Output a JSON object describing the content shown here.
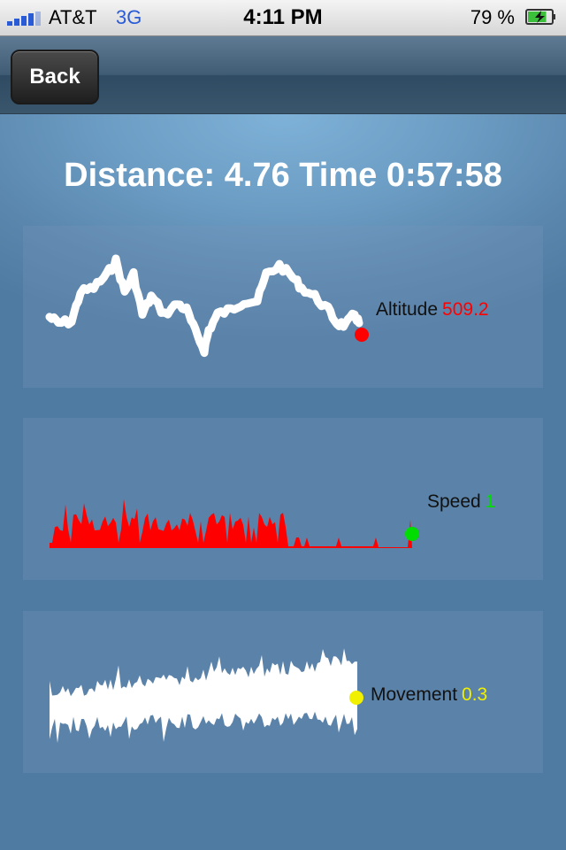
{
  "status": {
    "carrier": "AT&T",
    "network": "3G",
    "time": "4:11 PM",
    "battery": "79 %",
    "network_color": "#2a5bd7",
    "battery_charge_fraction": 0.79
  },
  "nav": {
    "back_label": "Back"
  },
  "summary": "Distance: 4.76 Time 0:57:58",
  "metrics": {
    "altitude": {
      "label": "Altitude",
      "value": "509.2",
      "color": "#ff0000",
      "line_color": "#ffffff"
    },
    "speed": {
      "label": "Speed",
      "value": "1",
      "color": "#00dd00",
      "line_color": "#ff0000"
    },
    "movement": {
      "label": "Movement",
      "value": "0.3",
      "color": "#f0f000",
      "line_color": "#ffffff"
    }
  }
}
